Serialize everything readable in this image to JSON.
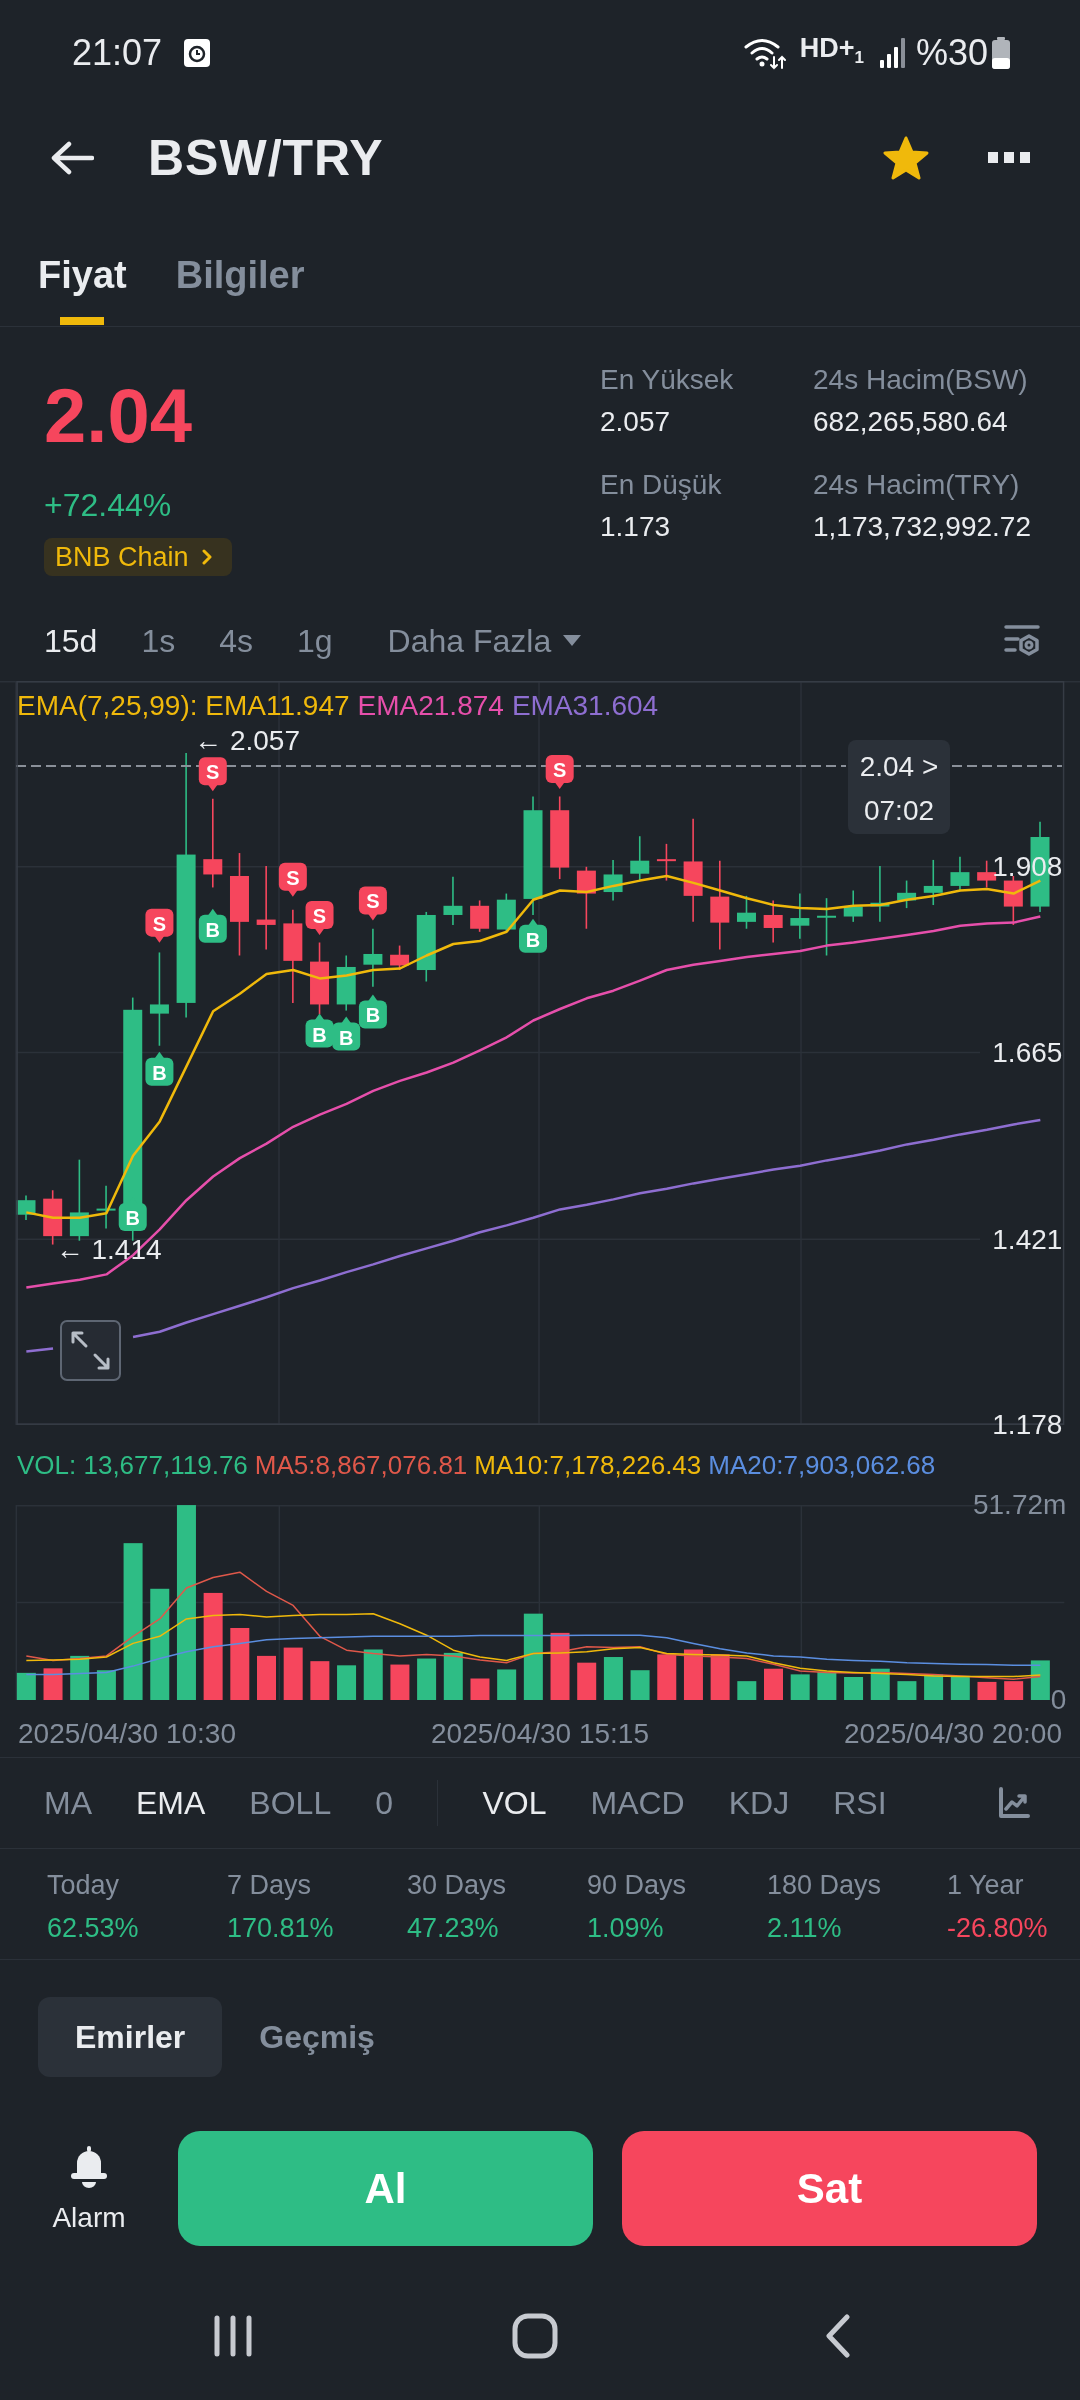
{
  "status_bar": {
    "time": "21:07",
    "network": "HD+$_{1}$",
    "battery": "%30"
  },
  "header": {
    "title": "BSW/TRY",
    "favorite": true
  },
  "tabs": [
    {
      "label": "Fiyat",
      "selected": true
    },
    {
      "label": "Bilgiler",
      "selected": false
    }
  ],
  "ticker": {
    "price": "2.04",
    "price_up": false,
    "change": "+72.44%",
    "change_up": true,
    "network": "BNB Chain",
    "stats": [
      {
        "label": "En Yüksek",
        "value": "2.057"
      },
      {
        "label": "24s Hacim(BSW)",
        "value": "682,265,580.64"
      },
      {
        "label": "En Düşük",
        "value": "1.173"
      },
      {
        "label": "24s Hacim(TRY)",
        "value": "1,173,732,992.72"
      }
    ]
  },
  "intervals": {
    "items": [
      {
        "label": "15d",
        "selected": true
      },
      {
        "label": "1s",
        "selected": false
      },
      {
        "label": "4s",
        "selected": false
      },
      {
        "label": "1g",
        "selected": false
      }
    ],
    "more": "Daha Fazla"
  },
  "price_chart": {
    "legend": [
      {
        "text": "EMA(7,25,99): EMA11.947",
        "color": "#f0b90b"
      },
      {
        "text": "EMA21.874",
        "color": "#e64fab"
      },
      {
        "text": "EMA31.604",
        "color": "#8e6ed1"
      }
    ],
    "price_tag": {
      "price": "2.04 >",
      "countdown": "07:02"
    },
    "extremes": [
      {
        "kind": "high",
        "text": "← 2.057"
      },
      {
        "kind": "low",
        "text": "← 1.414"
      }
    ],
    "trade_markers": [
      {
        "kind": "buy",
        "text": "B"
      },
      {
        "kind": "sell",
        "text": "S"
      },
      {
        "kind": "buy",
        "text": "B"
      },
      {
        "kind": "sell",
        "text": "S"
      },
      {
        "kind": "buy",
        "text": "B"
      },
      {
        "kind": "sell",
        "text": "S"
      },
      {
        "kind": "sell",
        "text": "S"
      },
      {
        "kind": "buy",
        "text": "B"
      },
      {
        "kind": "buy",
        "text": "B"
      },
      {
        "kind": "sell",
        "text": "S"
      },
      {
        "kind": "buy",
        "text": "B"
      },
      {
        "kind": "buy",
        "text": "B"
      },
      {
        "kind": "sell",
        "text": "S"
      }
    ],
    "chart_data": {
      "type": "line",
      "categories": [
        null,
        null,
        null,
        null,
        null,
        null,
        null,
        null,
        null,
        null,
        null,
        null,
        null,
        null,
        null,
        null,
        null,
        null,
        null,
        null,
        null,
        null,
        null,
        null,
        null,
        null,
        null,
        null,
        null,
        null,
        null,
        null,
        null,
        null,
        null,
        null,
        null,
        null,
        null
      ],
      "ylim": [
        1.178,
        2.151
      ],
      "yticks": [
        1.178,
        1.421,
        1.665,
        1.908
      ],
      "grid": true,
      "series": [
        {
          "color": "#f0b90b",
          "values": [
            1.456,
            1.449,
            1.449,
            1.455,
            1.53,
            1.575,
            1.647,
            1.719,
            1.742,
            1.768,
            1.773,
            1.762,
            1.766,
            1.773,
            1.775,
            1.792,
            1.807,
            1.811,
            1.823,
            1.865,
            1.877,
            1.875,
            1.883,
            1.89,
            1.896,
            1.887,
            1.877,
            1.867,
            1.858,
            1.854,
            1.853,
            1.857,
            1.858,
            1.865,
            1.87,
            1.877,
            1.879,
            1.873,
            1.89
          ]
        },
        {
          "color": "#e64fab",
          "values": [
            1.358,
            1.363,
            1.368,
            1.375,
            1.4,
            1.434,
            1.472,
            1.503,
            1.527,
            1.546,
            1.568,
            1.584,
            1.598,
            1.615,
            1.628,
            1.639,
            1.652,
            1.668,
            1.685,
            1.707,
            1.722,
            1.736,
            1.746,
            1.759,
            1.773,
            1.78,
            1.785,
            1.79,
            1.794,
            1.798,
            1.805,
            1.809,
            1.814,
            1.819,
            1.824,
            1.831,
            1.834,
            1.835,
            1.843
          ]
        },
        {
          "color": "#8e6ed1",
          "values": [
            1.274,
            1.278,
            null,
            null,
            1.293,
            1.3,
            1.312,
            1.323,
            1.334,
            1.345,
            1.357,
            1.367,
            1.378,
            1.388,
            1.399,
            1.409,
            1.419,
            1.43,
            1.439,
            1.449,
            1.46,
            1.466,
            1.473,
            1.481,
            1.487,
            1.494,
            1.5,
            1.506,
            1.512,
            1.517,
            1.524,
            1.53,
            1.537,
            1.545,
            1.551,
            1.558,
            1.564,
            1.571,
            1.577
          ]
        }
      ]
    }
  },
  "volume_chart": {
    "legend": [
      {
        "text": "VOL: 13,677,119.76",
        "color": "#2ebd85"
      },
      {
        "text": "MA5:8,867,076.81",
        "color": "#e0584a"
      },
      {
        "text": "MA10:7,178,226.43",
        "color": "#f0b90b"
      },
      {
        "text": "MA20:7,903,062.68",
        "color": "#5b8ee0"
      }
    ],
    "chart_data": {
      "type": "bar",
      "stacked": true,
      "categories": [
        null,
        null,
        null,
        null,
        null,
        null,
        null,
        null,
        null,
        null,
        null,
        null,
        null,
        null,
        null,
        null,
        null,
        null,
        null,
        null,
        null,
        null,
        null,
        null,
        null,
        null,
        null,
        null,
        null,
        null,
        null,
        null,
        null,
        null,
        null,
        null,
        null,
        null,
        null
      ],
      "ylim": [
        0,
        51.72
      ],
      "yticks": [
        {
          "value": 0,
          "label": "0"
        },
        {
          "value": 51.72,
          "label": "51.72m"
        }
      ],
      "grid": true,
      "series": [
        {
          "color": "#2ebd85",
          "values": [
            7.2,
            null,
            11.7,
            7.9,
            41.6,
            29.5,
            51.7,
            null,
            null,
            null,
            null,
            null,
            9.2,
            13.4,
            null,
            11.0,
            12.5,
            null,
            8.1,
            22.9,
            null,
            null,
            11.4,
            7.9,
            null,
            null,
            null,
            5.0,
            null,
            6.8,
            7.5,
            6.1,
            8.3,
            5.0,
            6.8,
            6.4,
            null,
            null,
            10.5
          ]
        },
        {
          "color": "#f6465d",
          "values": [
            null,
            8.4,
            null,
            null,
            null,
            null,
            null,
            28.4,
            19.1,
            11.7,
            13.9,
            10.3,
            null,
            null,
            9.4,
            null,
            null,
            5.7,
            null,
            null,
            17.8,
            9.9,
            null,
            null,
            12.1,
            13.4,
            12.1,
            null,
            8.3,
            null,
            null,
            null,
            null,
            null,
            null,
            null,
            4.8,
            5.0,
            null
          ]
        },
        {
          "type": "line",
          "color": "#e0584a",
          "values": [
            11.7,
            10.5,
            11.0,
            11.7,
            16.9,
            21.5,
            29.7,
            32.5,
            33.9,
            28.8,
            25.1,
            16.9,
            13.2,
            12.3,
            11.7,
            12.1,
            11.7,
            10.6,
            9.9,
            12.3,
            12.8,
            14.1,
            13.9,
            14.1,
            12.1,
            11.7,
            11.4,
            11.0,
            9.5,
            7.7,
            7.3,
            7.2,
            7.3,
            7.0,
            6.8,
            6.4,
            5.9,
            5.5,
            6.2
          ]
        },
        {
          "type": "line",
          "color": "#f0b90b",
          "values": [
            10.5,
            10.6,
            10.8,
            11.4,
            15.0,
            16.9,
            21.5,
            22.4,
            22.7,
            22.0,
            22.4,
            22.7,
            22.7,
            22.9,
            20.2,
            17.2,
            13.2,
            11.4,
            10.5,
            12.3,
            12.5,
            12.8,
            13.6,
            13.9,
            12.3,
            12.1,
            11.9,
            11.7,
            9.9,
            8.4,
            7.7,
            7.3,
            7.0,
            6.8,
            6.4,
            6.2,
            6.2,
            6.2,
            6.6
          ]
        },
        {
          "type": "line",
          "color": "#5b8ee0",
          "values": [
            6.8,
            6.8,
            7.0,
            7.3,
            9.0,
            11.0,
            12.8,
            14.1,
            15.0,
            16.0,
            16.3,
            16.5,
            16.7,
            16.9,
            16.9,
            16.9,
            16.9,
            17.1,
            17.1,
            17.1,
            17.1,
            17.2,
            17.2,
            17.2,
            16.5,
            15.0,
            13.6,
            12.5,
            11.7,
            11.4,
            10.8,
            10.5,
            10.3,
            9.9,
            9.7,
            9.5,
            9.4,
            9.2,
            9.2
          ]
        }
      ]
    },
    "time_labels": [
      "2025/04/30 10:30",
      "2025/04/30 15:15",
      "2025/04/30 20:00"
    ]
  },
  "indicators": {
    "main": [
      {
        "label": "MA",
        "selected": false
      },
      {
        "label": "EMA",
        "selected": true
      },
      {
        "label": "BOLL",
        "selected": false
      },
      {
        "label": "0",
        "selected": false
      }
    ],
    "sub": [
      {
        "label": "VOL",
        "selected": true
      },
      {
        "label": "MACD",
        "selected": false
      },
      {
        "label": "KDJ",
        "selected": false
      },
      {
        "label": "RSI",
        "selected": false
      }
    ]
  },
  "performance": [
    {
      "label": "Today",
      "value": "62.53%",
      "up": true
    },
    {
      "label": "7 Days",
      "value": "170.81%",
      "up": true
    },
    {
      "label": "30 Days",
      "value": "47.23%",
      "up": true
    },
    {
      "label": "90 Days",
      "value": "1.09%",
      "up": true
    },
    {
      "label": "180 Days",
      "value": "2.11%",
      "up": true
    },
    {
      "label": "1 Year",
      "value": "-26.80%",
      "up": false
    }
  ],
  "order_tabs": [
    {
      "label": "Emirler",
      "selected": true
    },
    {
      "label": "Geçmiş",
      "selected": false
    }
  ],
  "actions": {
    "alarm": "Alarm",
    "buttons": [
      {
        "label": "Al",
        "kind": "buy"
      },
      {
        "label": "Sat",
        "kind": "sell"
      }
    ]
  }
}
